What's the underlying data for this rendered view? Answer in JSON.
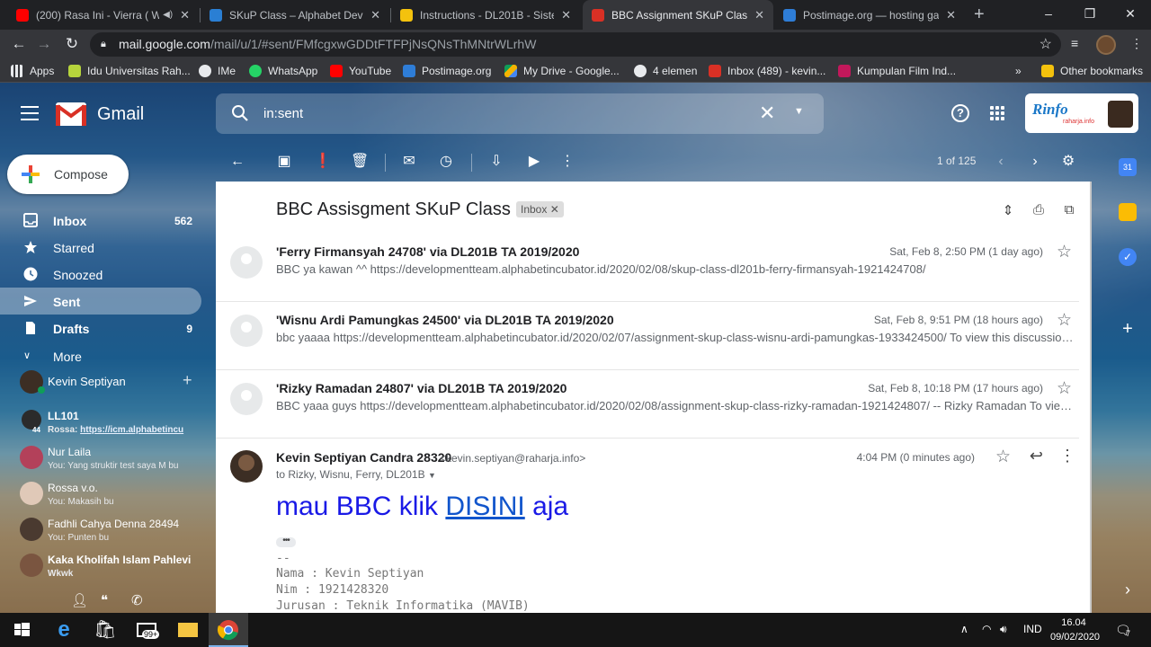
{
  "browser": {
    "tabs": [
      {
        "title": "(200) Rasa Ini - Vierra ( Wi",
        "favicon_color": "#ff0000",
        "audio_icon": "speaker-icon",
        "active": false
      },
      {
        "title": "SKuP Class – Alphabet Develop",
        "favicon_color": "#2a7fd4",
        "active": false
      },
      {
        "title": "Instructions - DL201B - Sistem",
        "favicon_color": "#f4c20d",
        "active": false
      },
      {
        "title": "BBC Assignment SKuP Class - k",
        "favicon_color": "#d93025",
        "active": true
      },
      {
        "title": "Postimage.org — hosting gam",
        "favicon_color": "#2e7dd7",
        "active": false
      }
    ],
    "new_tab_label": "+",
    "window_controls": [
      "–",
      "❐",
      "✕"
    ],
    "address": {
      "host": "mail.google.com",
      "path": "/mail/u/1/#sent/FMfcgxwGDDtFTFPjNsQNsThMNtrWLrhW"
    },
    "bookmarks": [
      {
        "label": "Apps",
        "icon": "apps-grid-icon",
        "color": "#e8eaed"
      },
      {
        "label": "Idu Universitas Rah...",
        "icon": "idu-icon",
        "color": "#b6d43c"
      },
      {
        "label": "IMe",
        "icon": "globe-icon",
        "color": "#e8eaed"
      },
      {
        "label": "WhatsApp",
        "icon": "whatsapp-icon",
        "color": "#25d366"
      },
      {
        "label": "YouTube",
        "icon": "youtube-icon",
        "color": "#ff0000"
      },
      {
        "label": "Postimage.org",
        "icon": "postimage-icon",
        "color": "#2e7dd7"
      },
      {
        "label": "My Drive - Google...",
        "icon": "drive-icon",
        "color": "#f4b400"
      },
      {
        "label": "4 elemen",
        "icon": "globe-icon",
        "color": "#e8eaed"
      },
      {
        "label": "Inbox (489) - kevin...",
        "icon": "gmail-icon",
        "color": "#d93025"
      },
      {
        "label": "Kumpulan Film Ind...",
        "icon": "film-icon",
        "color": "#c2185b"
      }
    ],
    "bookmarks_overflow": "»",
    "other_bookmarks": "Other bookmarks"
  },
  "gmail": {
    "brand": "Gmail",
    "search_value": "in:sent",
    "account_brand": "Rinfo",
    "account_brand_sub": "raharja.info",
    "compose_label": "Compose",
    "nav": [
      {
        "label": "Inbox",
        "count": "562",
        "icon": "inbox-icon",
        "active": false
      },
      {
        "label": "Starred",
        "count": "",
        "icon": "star-icon",
        "active": false
      },
      {
        "label": "Snoozed",
        "count": "",
        "icon": "clock-icon",
        "active": false
      },
      {
        "label": "Sent",
        "count": "",
        "icon": "send-icon",
        "active": true
      },
      {
        "label": "Drafts",
        "count": "9",
        "icon": "draft-icon",
        "active": false
      },
      {
        "label": "More",
        "count": "",
        "icon": "chevron-down-icon",
        "active": false
      }
    ],
    "hangouts_me": "Kevin Septiyan",
    "hangouts": [
      {
        "name": "LL101",
        "message_prefix": "Rossa:",
        "message": "https://icm.alphabetincu",
        "badge": "44",
        "avatar_color": "#2b2b2b"
      },
      {
        "name": "Nur Laila",
        "message_prefix": "You:",
        "message": "Yang struktir test saya M bu",
        "avatar_color": "#b3415a"
      },
      {
        "name": "Rossa v.o.",
        "message_prefix": "You:",
        "message": "Makasih bu",
        "avatar_color": "#e0c9b8"
      },
      {
        "name": "Fadhli Cahya Denna 28494",
        "message_prefix": "You:",
        "message": "Punten bu",
        "avatar_color": "#4a3a30"
      },
      {
        "name": "Kaka Kholifah Islam Pahlevi",
        "message_prefix": "",
        "message": "Wkwk",
        "avatar_color": "#7a5540"
      }
    ],
    "pager": "1 of 125",
    "subject": "BBC Assisgment SKuP Class",
    "subject_label": "Inbox",
    "threads": [
      {
        "sender": "'Ferry Firmansyah 24708' via DL201B TA 2019/2020",
        "snippet": "BBC ya kawan ^^ https://developmentteam.alphabetincubator.id/2020/02/08/skup-class-dl201b-ferry-firmansyah-1921424708/",
        "date": "Sat, Feb 8, 2:50 PM (1 day ago)"
      },
      {
        "sender": "'Wisnu Ardi Pamungkas 24500' via DL201B TA 2019/2020",
        "snippet": "bbc yaaaa https://developmentteam.alphabetincubator.id/2020/02/07/assignment-skup-class-wisnu-ardi-pamungkas-1933424500/ To view this discussion on the web visit",
        "date": "Sat, Feb 8, 9:51 PM (18 hours ago)"
      },
      {
        "sender": "'Rizky Ramadan 24807' via DL201B TA 2019/2020",
        "snippet": "BBC yaaa guys https://developmentteam.alphabetincubator.id/2020/02/08/assignment-skup-class-rizky-ramadan-1921424807/ -- Rizky Ramadan To view this discussion on the web",
        "date": "Sat, Feb 8, 10:18 PM (17 hours ago)"
      }
    ],
    "open_message": {
      "sender": "Kevin Septiyan Candra 28320",
      "email": "<kevin.septiyan@raharja.info>",
      "to": "to Rizky, Wisnu, Ferry, DL201B",
      "date": "4:04 PM (0 minutes ago)",
      "body_before": "mau BBC klik ",
      "body_link": "DISINI",
      "body_after": " aja",
      "dots": "•••",
      "sig_separator": "--",
      "sig_name": "Nama : Kevin Septiyan",
      "sig_nim": "Nim : 1921428320",
      "sig_jurusan": "Jurusan : Teknik Informatika (MAVIB)"
    }
  },
  "taskbar": {
    "language": "IND",
    "time": "16.04",
    "date": "09/02/2020",
    "store_badge": "99+",
    "notification_count": "7"
  }
}
